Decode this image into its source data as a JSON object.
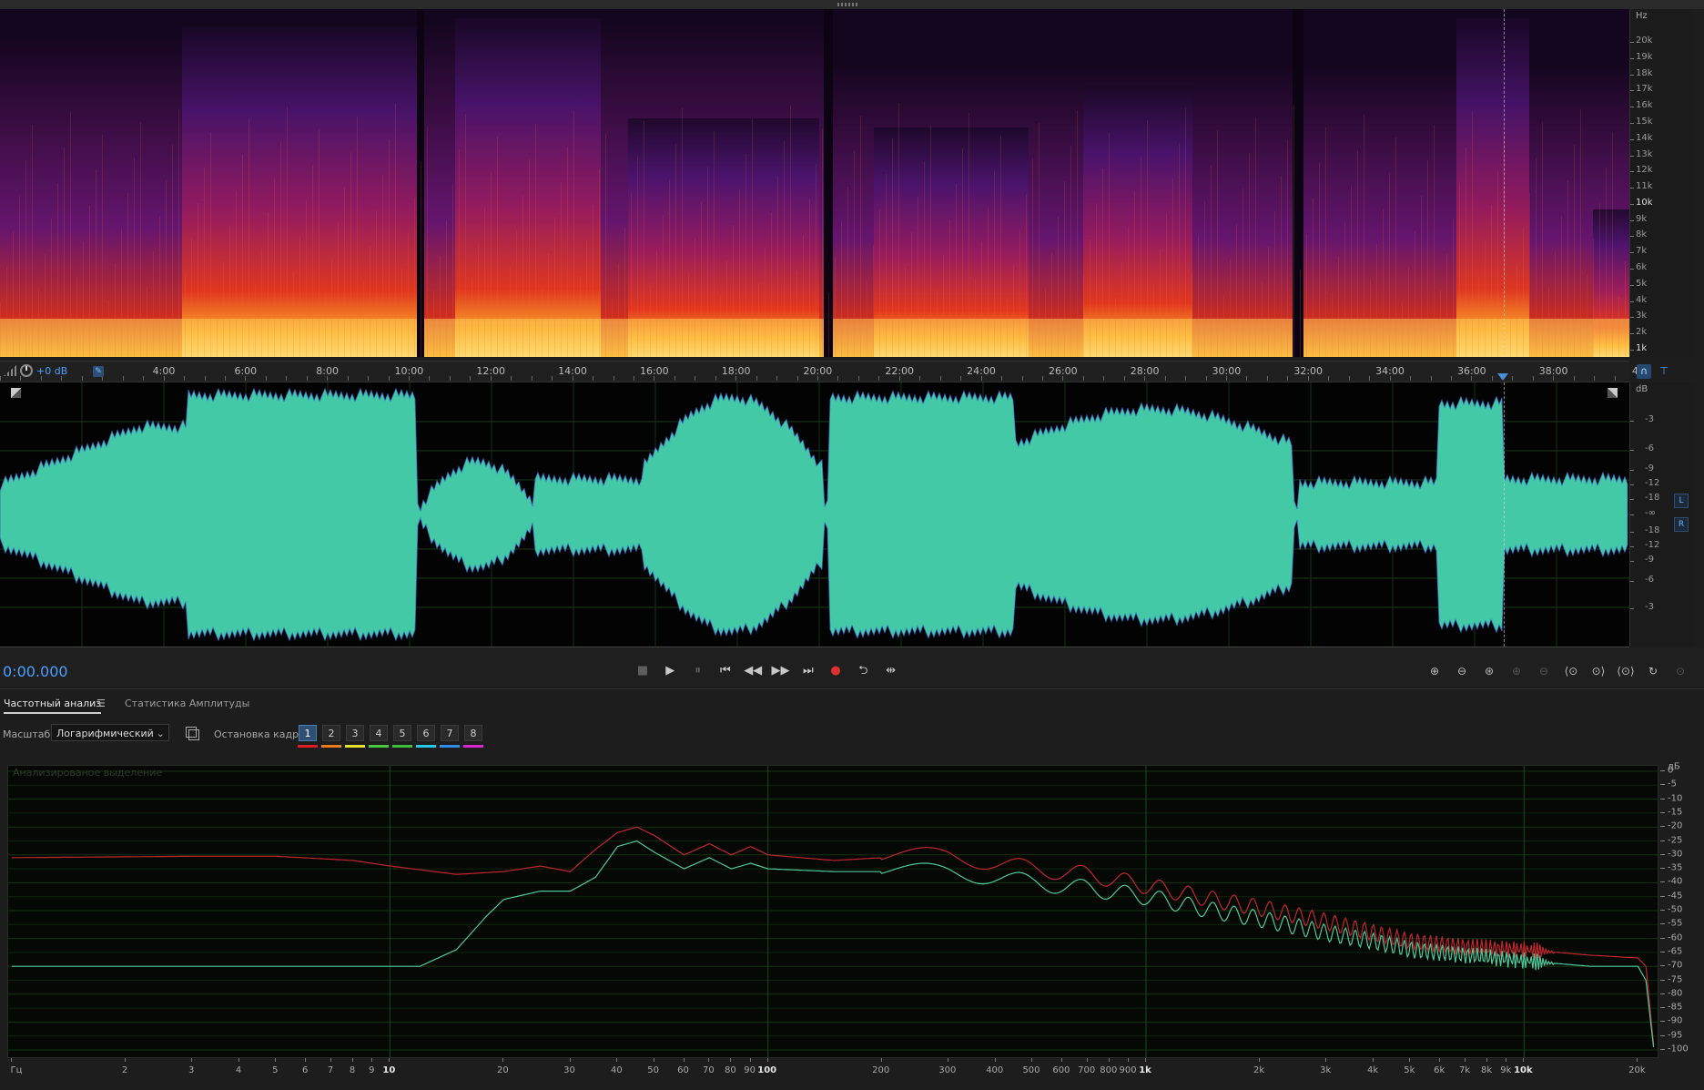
{
  "spectrogram": {
    "unit": "Hz",
    "labels": [
      "20k",
      "19k",
      "18k",
      "17k",
      "16k",
      "15k",
      "14k",
      "13k",
      "12k",
      "11k",
      "10k",
      "9k",
      "8k",
      "7k",
      "6k",
      "5k",
      "4k",
      "3k",
      "2k",
      "1k"
    ]
  },
  "timeline": {
    "gain": "+0 dB",
    "ticks": [
      "4:00",
      "6:00",
      "8:00",
      "10:00",
      "12:00",
      "14:00",
      "16:00",
      "18:00",
      "20:00",
      "22:00",
      "24:00",
      "26:00",
      "28:00",
      "30:00",
      "32:00",
      "34:00",
      "36:00",
      "38:00",
      "4"
    ]
  },
  "waveform": {
    "unit": "dB",
    "labels": [
      "-3",
      "-6",
      "-9",
      "-12",
      "-18",
      "-∞",
      "-18",
      "-12",
      "-9",
      "-6",
      "-3"
    ],
    "channels": [
      "L",
      "R"
    ]
  },
  "transport": {
    "time": "0:00.000",
    "buttons": [
      {
        "name": "stop-button",
        "glyph": "■",
        "dim": true
      },
      {
        "name": "play-button",
        "glyph": "▶",
        "dim": false
      },
      {
        "name": "pause-button",
        "glyph": "⏸",
        "dim": true
      },
      {
        "name": "go-to-start-button",
        "glyph": "⏮",
        "dim": false
      },
      {
        "name": "rewind-button",
        "glyph": "◀◀",
        "dim": false
      },
      {
        "name": "fast-forward-button",
        "glyph": "▶▶",
        "dim": false
      },
      {
        "name": "go-to-end-button",
        "glyph": "⏭",
        "dim": false
      },
      {
        "name": "record-button",
        "glyph": "●",
        "rec": true
      },
      {
        "name": "loop-button",
        "glyph": "⮌",
        "dim": false
      },
      {
        "name": "skip-selection-button",
        "glyph": "⇹",
        "dim": false
      }
    ],
    "zoom_buttons": [
      {
        "name": "zoom-in-amplitude-button",
        "glyph": "⊕",
        "dim": false
      },
      {
        "name": "zoom-out-amplitude-button",
        "glyph": "⊖",
        "dim": false
      },
      {
        "name": "zoom-reset-button",
        "glyph": "⊛",
        "dim": false
      },
      {
        "name": "zoom-in-time-button",
        "glyph": "⊕",
        "dim": true
      },
      {
        "name": "zoom-out-time-button",
        "glyph": "⊖",
        "dim": true
      },
      {
        "name": "zoom-selection-left-button",
        "glyph": "⟨⊙",
        "dim": false
      },
      {
        "name": "zoom-selection-right-button",
        "glyph": "⊙⟩",
        "dim": false
      },
      {
        "name": "zoom-full-button",
        "glyph": "⟨⊙⟩",
        "dim": false
      },
      {
        "name": "zoom-history-button",
        "glyph": "↻",
        "dim": false
      },
      {
        "name": "zoom-extra-button",
        "glyph": "⊙",
        "dim": true
      }
    ]
  },
  "panel": {
    "tabs": [
      {
        "label": "Частотный анализ",
        "active": true
      },
      {
        "label": "Статистика Амплитуды",
        "active": false
      }
    ],
    "scale_label": "Масштаб:",
    "scale_value": "Логарифмический",
    "frame_label": "Остановка кадра:",
    "frames": [
      "1",
      "2",
      "3",
      "4",
      "5",
      "6",
      "7",
      "8"
    ],
    "frame_colors": [
      "#e01d1d",
      "#f07b1a",
      "#e6e02a",
      "#47c83e",
      "#3fbe3a",
      "#27c6e6",
      "#2f8fe8",
      "#d925d2"
    ],
    "plot_note": "Анализированое выделение"
  },
  "chart_data": {
    "type": "line",
    "x_scale": "log",
    "xlim": [
      1,
      22050
    ],
    "ylim": [
      -100,
      0
    ],
    "xlabel": "Гц",
    "ylabel": "дБ",
    "x_tick_labels": [
      "Гц",
      "2",
      "3",
      "4",
      "5",
      "6",
      "7",
      "8",
      "9",
      "10",
      "20",
      "30",
      "40",
      "50",
      "60",
      "70",
      "80",
      "90",
      "100",
      "200",
      "300",
      "400",
      "500",
      "600",
      "700",
      "800",
      "900",
      "1k",
      "2k",
      "3k",
      "4k",
      "5k",
      "6k",
      "7k",
      "8k",
      "9k",
      "10k",
      "20k"
    ],
    "y_tick_labels": [
      "0",
      "-5",
      "-10",
      "-15",
      "-20",
      "-25",
      "-30",
      "-35",
      "-40",
      "-45",
      "-50",
      "-55",
      "-60",
      "-65",
      "-70",
      "-75",
      "-80",
      "-85",
      "-90",
      "-95",
      "-100"
    ],
    "series": [
      {
        "color": "#c0272d",
        "x": [
          1,
          3,
          5,
          8,
          10,
          15,
          20,
          25,
          30,
          35,
          40,
          45,
          50,
          60,
          70,
          80,
          90,
          100,
          150,
          200,
          300,
          400,
          500,
          700,
          1000,
          1500,
          2000,
          3000,
          4000,
          5000,
          7000,
          10000,
          15000,
          20000,
          21000,
          22000
        ],
        "y": [
          -31,
          -30.5,
          -30.5,
          -32,
          -34,
          -37,
          -36,
          -34,
          -36,
          -28,
          -22,
          -20,
          -23,
          -30,
          -26,
          -30,
          -27,
          -30,
          -32,
          -31,
          -30,
          -33,
          -35,
          -37,
          -41,
          -46,
          -49,
          -54,
          -58,
          -61,
          -63,
          -64,
          -66,
          -67,
          -70,
          -98
        ]
      },
      {
        "color": "#4fc99a",
        "x": [
          1,
          5,
          10,
          12,
          15,
          18,
          20,
          25,
          30,
          35,
          40,
          45,
          50,
          60,
          70,
          80,
          90,
          100,
          150,
          200,
          300,
          400,
          500,
          700,
          1000,
          1500,
          2000,
          3000,
          4000,
          5000,
          7000,
          10000,
          15000,
          20000,
          21000,
          22000
        ],
        "y": [
          -70,
          -70,
          -70,
          -70,
          -64,
          -52,
          -46,
          -43,
          -43,
          -38,
          -27,
          -25,
          -29,
          -35,
          -31,
          -35,
          -33,
          -35,
          -36,
          -36,
          -36,
          -38,
          -40,
          -42,
          -45,
          -50,
          -53,
          -58,
          -61,
          -64,
          -66,
          -68,
          -70,
          -70,
          -75,
          -99
        ]
      }
    ]
  }
}
